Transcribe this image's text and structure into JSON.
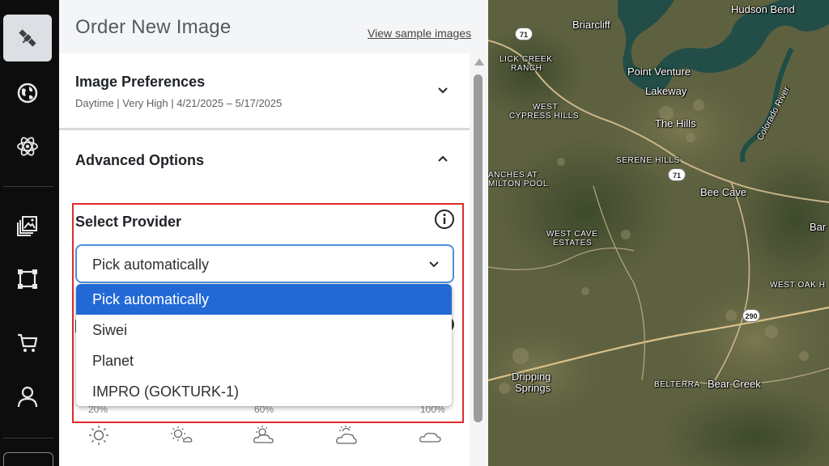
{
  "panel": {
    "title": "Order New Image",
    "sample_link": "View sample images"
  },
  "preferences": {
    "title": "Image Preferences",
    "summary": "Daytime | Very High | 4/21/2025 – 5/17/2025"
  },
  "advanced": {
    "title": "Advanced Options"
  },
  "provider": {
    "label": "Select Provider",
    "selected": "Pick automatically",
    "options": [
      "Pick automatically",
      "Siwei",
      "Planet",
      "IMPRO (GOKTURK-1)"
    ]
  },
  "cloud_cover": {
    "ticks": [
      "20%",
      "60%",
      "100%"
    ],
    "icons": [
      "sun-icon",
      "sun-small-cloud-icon",
      "sun-cloud-icon",
      "partly-cloudy-icon",
      "cloud-icon"
    ]
  },
  "rail": {
    "items": [
      "satellite-icon",
      "globe-icon",
      "atom-icon",
      "images-icon",
      "area-select-icon",
      "cart-icon",
      "user-icon"
    ]
  },
  "map": {
    "labels": {
      "hudson_bend": "Hudson Bend",
      "briarcliff": "Briarcliff",
      "lick_creek_1": "LICK CREEK",
      "lick_creek_2": "RANCH",
      "point_venture": "Point Venture",
      "lakeway": "Lakeway",
      "west_cypress_1": "WEST",
      "west_cypress_2": "CYPRESS HILLS",
      "the_hills": "The Hills",
      "colorado_river": "Colorado River",
      "serene_hills": "SERENE HILLS",
      "ranches_1": "ANCHES AT",
      "ranches_2": "MILTON POOL",
      "bee_cave": "Bee Cave",
      "west_cave_1": "WEST CAVE",
      "west_cave_2": "ESTATES",
      "bar": "Bar",
      "west_oak": "WEST OAK H",
      "dripping_1": "Dripping",
      "dripping_2": "Springs",
      "belterra": "BELTERRA",
      "bear_creek": "Bear Creek"
    },
    "shields": {
      "r71_a": "71",
      "r71_b": "71",
      "r290": "290"
    }
  }
}
